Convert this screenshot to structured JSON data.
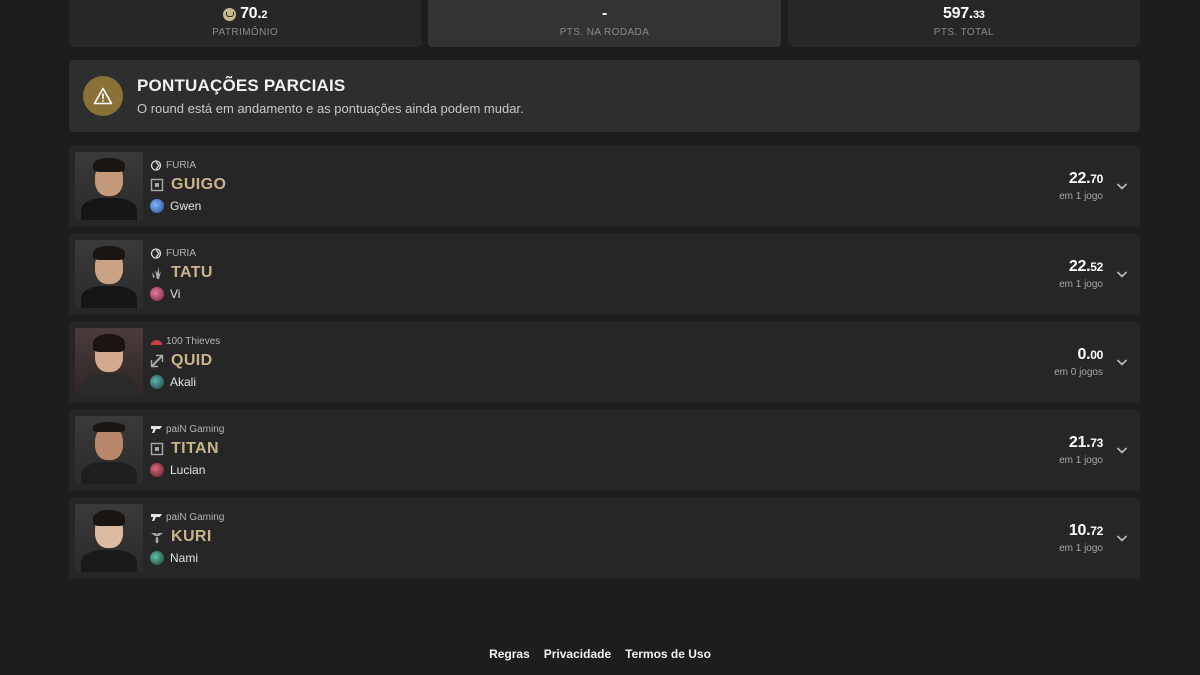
{
  "stats": [
    {
      "whole": "70.",
      "frac": "2",
      "label": "PATRIMÔNIO",
      "icon": "coin-icon"
    },
    {
      "whole": "-",
      "frac": "",
      "label": "PTS. NA RODADA"
    },
    {
      "whole": "597.",
      "frac": "33",
      "label": "PTS. TOTAL"
    }
  ],
  "alert": {
    "title": "PONTUAÇÕES PARCIAIS",
    "message": "O round está em andamento e as pontuações ainda podem mudar.",
    "icon": "warning-icon",
    "color": "#8a7137"
  },
  "players": [
    {
      "team": "FURIA",
      "name": "GUIGO",
      "role": "top",
      "champion": "Gwen",
      "score_whole": "22.",
      "score_frac": "70",
      "games": "em 1 jogo"
    },
    {
      "team": "FURIA",
      "name": "TATU",
      "role": "jungle",
      "champion": "Vi",
      "score_whole": "22.",
      "score_frac": "52",
      "games": "em 1 jogo"
    },
    {
      "team": "100 Thieves",
      "name": "QUID",
      "role": "mid",
      "champion": "Akali",
      "score_whole": "0.",
      "score_frac": "00",
      "games": "em 0 jogos"
    },
    {
      "team": "paiN Gaming",
      "name": "TITAN",
      "role": "bot",
      "champion": "Lucian",
      "score_whole": "21.",
      "score_frac": "73",
      "games": "em 1 jogo"
    },
    {
      "team": "paiN Gaming",
      "name": "KURI",
      "role": "support",
      "champion": "Nami",
      "score_whole": "10.",
      "score_frac": "72",
      "games": "em 1 jogo"
    }
  ],
  "footer": {
    "links": [
      "Regras",
      "Privacidade",
      "Termos de Uso"
    ]
  },
  "colors": {
    "accent": "#c8b48a",
    "background": "#1d1d1d",
    "card": "#262626"
  }
}
